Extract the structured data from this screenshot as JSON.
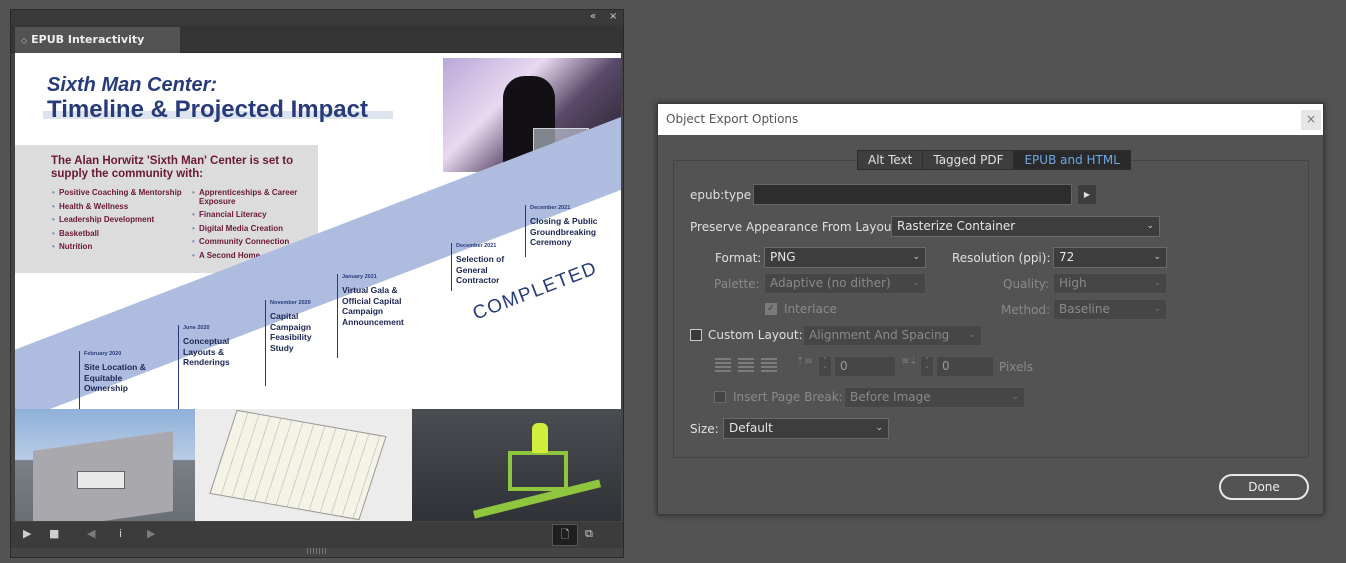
{
  "epub_panel": {
    "collapse_icon": "«",
    "close_icon": "×",
    "tab_label": "EPUB Interactivity Preview",
    "tab_glyph": "◇"
  },
  "preview": {
    "title_line1": "Sixth Man Center:",
    "title_line2": "Timeline & Projected Impact",
    "community_heading": "The Alan Horwitz 'Sixth Man' Center is set to supply the community with:",
    "community_left": [
      "Positive Coaching & Mentorship",
      "Health & Wellness",
      "Leadership Development",
      "Basketball",
      "Nutrition"
    ],
    "community_right": [
      "Apprenticeships & Career Exposure",
      "Financial Literacy",
      "Digital Media Creation",
      "Community Connection",
      "A Second Home"
    ],
    "completed_label": "COMPLETED",
    "milestones": [
      {
        "date": "February 2020",
        "title": "Site Location & Equitable Ownership"
      },
      {
        "date": "June 2020",
        "title": "Conceptual Layouts & Renderings"
      },
      {
        "date": "November 2020",
        "title": "Capital Campaign Feasibility Study"
      },
      {
        "date": "January 2021",
        "title": "Virtual Gala & Official Capital Campaign Announcement"
      },
      {
        "date": "December 2021",
        "title": "Selection of General Contractor"
      },
      {
        "date": "December 2021",
        "title": "Closing & Public Groundbreaking Ceremony"
      }
    ]
  },
  "preview_controls": {
    "play": "▶",
    "stop": "■",
    "prev": "◀",
    "info": "i",
    "next": "▶",
    "page_icon": "🗋",
    "spread_icon": "⧉"
  },
  "dialog": {
    "title": "Object Export Options",
    "close_glyph": "×",
    "tabs": [
      {
        "label": "Alt Text",
        "active": false
      },
      {
        "label": "Tagged PDF",
        "active": false
      },
      {
        "label": "EPUB and HTML",
        "active": true
      }
    ],
    "epub_type_label": "epub:type",
    "epub_type_value": "",
    "epub_type_arrow": "▶",
    "preserve_label": "Preserve Appearance From Layout:",
    "preserve_value": "Rasterize Container",
    "format_label": "Format:",
    "format_value": "PNG",
    "resolution_label": "Resolution (ppi):",
    "resolution_value": "72",
    "palette_label": "Palette:",
    "palette_value": "Adaptive (no dither)",
    "quality_label": "Quality:",
    "quality_value": "High",
    "interlace_label": "Interlace",
    "method_label": "Method:",
    "method_value": "Baseline",
    "custom_layout_label": "Custom Layout:",
    "custom_layout_value": "Alignment And Spacing",
    "spacing_before": "0",
    "spacing_after": "0",
    "pixels_label": "Pixels",
    "page_break_label": "Insert Page Break:",
    "page_break_value": "Before Image",
    "size_label": "Size:",
    "size_value": "Default",
    "done_label": "Done",
    "chevron": "⌄"
  }
}
